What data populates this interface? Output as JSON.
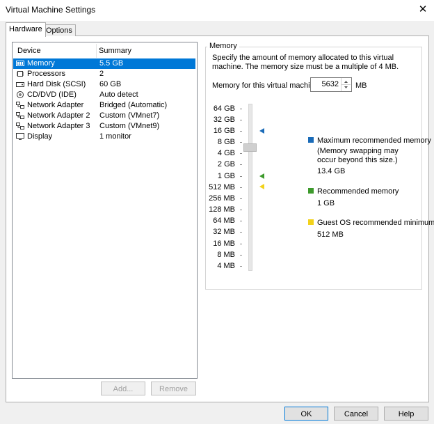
{
  "window": {
    "title": "Virtual Machine Settings",
    "close_glyph": "✕"
  },
  "tabs": [
    {
      "label": "Hardware"
    },
    {
      "label": "Options"
    }
  ],
  "device_list": {
    "headers": {
      "device": "Device",
      "summary": "Summary"
    },
    "rows": [
      {
        "icon": "memory-icon",
        "name": "Memory",
        "summary": "5.5 GB",
        "selected": true
      },
      {
        "icon": "processor-icon",
        "name": "Processors",
        "summary": "2"
      },
      {
        "icon": "hard-disk-icon",
        "name": "Hard Disk (SCSI)",
        "summary": "60 GB"
      },
      {
        "icon": "cd-dvd-icon",
        "name": "CD/DVD (IDE)",
        "summary": "Auto detect"
      },
      {
        "icon": "network-adapter-icon",
        "name": "Network Adapter",
        "summary": "Bridged (Automatic)"
      },
      {
        "icon": "network-adapter-icon",
        "name": "Network Adapter 2",
        "summary": "Custom (VMnet7)"
      },
      {
        "icon": "network-adapter-icon",
        "name": "Network Adapter 3",
        "summary": "Custom (VMnet9)"
      },
      {
        "icon": "display-icon",
        "name": "Display",
        "summary": "1 monitor"
      }
    ],
    "add_label": "Add...",
    "remove_label": "Remove"
  },
  "memory": {
    "group_title": "Memory",
    "description": "Specify the amount of memory allocated to this virtual machine. The memory size must be a multiple of 4 MB.",
    "field_label": "Memory for this virtual machine:",
    "value": "5632",
    "unit": "MB",
    "scale_labels": [
      "64 GB",
      "32 GB",
      "16 GB",
      "8 GB",
      "4 GB",
      "2 GB",
      "1 GB",
      "512 MB",
      "256 MB",
      "128 MB",
      "64 MB",
      "32 MB",
      "16 MB",
      "8 MB",
      "4 MB"
    ],
    "legend": {
      "max": {
        "title": "Maximum recommended memory",
        "note": "(Memory swapping may occur beyond this size.)",
        "value": "13.4 GB",
        "color": "#1a6bb8"
      },
      "recommended": {
        "title": "Recommended memory",
        "value": "1 GB",
        "color": "#3d9a2c"
      },
      "guest_min": {
        "title": "Guest OS recommended minimum",
        "value": "512 MB",
        "color": "#f2d21b"
      }
    }
  },
  "footer": {
    "ok": "OK",
    "cancel": "Cancel",
    "help": "Help"
  }
}
